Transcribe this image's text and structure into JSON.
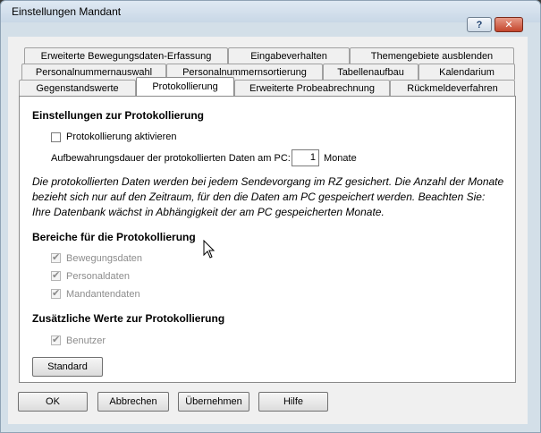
{
  "window": {
    "title": "Einstellungen Mandant",
    "help_label": "?",
    "close_label": "✕"
  },
  "tabs": {
    "row1": [
      "Erweiterte Bewegungsdaten-Erfassung",
      "Eingabeverhalten",
      "Themengebiete ausblenden"
    ],
    "row2": [
      "Personalnummernauswahl",
      "Personalnummernsortierung",
      "Tabellenaufbau",
      "Kalendarium"
    ],
    "row3": [
      "Gegenstandswerte",
      "Protokollierung",
      "Erweiterte Probeabrechnung",
      "Rückmeldeverfahren"
    ],
    "active": "Protokollierung"
  },
  "panel": {
    "section1_title": "Einstellungen zur Protokollierung",
    "enable_logging_label": "Protokollierung aktivieren",
    "enable_logging_checked": false,
    "retention_label": "Aufbewahrungsdauer der protokollierten Daten am PC:",
    "retention_value": "1",
    "retention_unit": "Monate",
    "info_text": "Die protokollierten Daten werden bei jedem Sendevorgang im RZ gesichert. Die Anzahl der Monate bezieht sich nur auf den Zeitraum, für den die Daten am PC gespeichert werden. Beachten Sie: Ihre Datenbank wächst in Abhängigkeit der am PC gespeicherten Monate.",
    "section2_title": "Bereiche für die Protokollierung",
    "areas": [
      {
        "label": "Bewegungsdaten",
        "checked": true
      },
      {
        "label": "Personaldaten",
        "checked": true
      },
      {
        "label": "Mandantendaten",
        "checked": true
      }
    ],
    "section3_title": "Zusätzliche Werte zur Protokollierung",
    "extra": [
      {
        "label": "Benutzer",
        "checked": true
      }
    ],
    "standard_button": "Standard"
  },
  "footer": {
    "ok": "OK",
    "cancel": "Abbrechen",
    "apply": "Übernehmen",
    "help": "Hilfe"
  }
}
